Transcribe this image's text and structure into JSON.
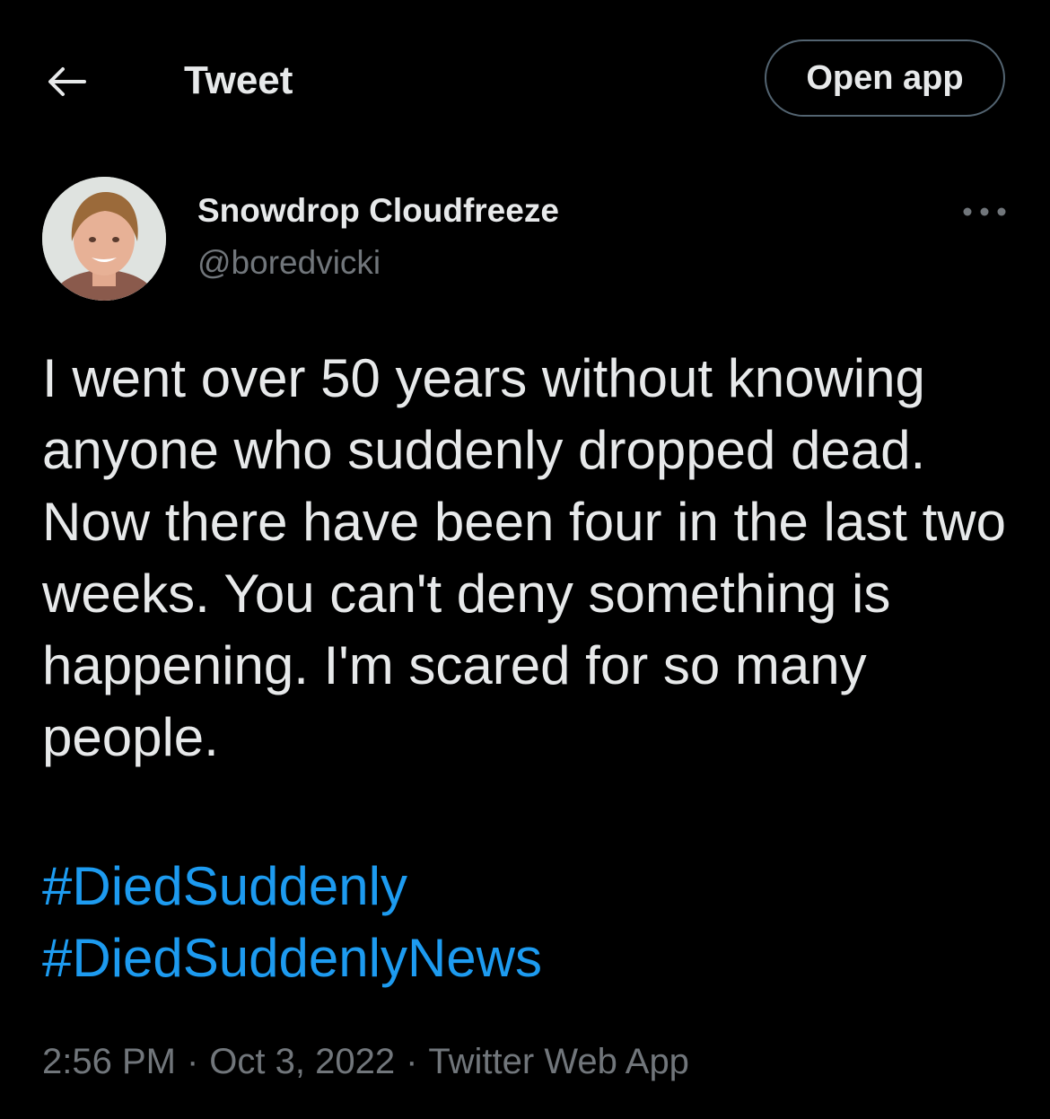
{
  "header": {
    "title": "Tweet",
    "open_app_label": "Open app",
    "back_icon": "arrow-left-icon"
  },
  "author": {
    "display_name": "Snowdrop Cloudfreeze",
    "handle": "@boredvicki",
    "avatar": "profile-photo",
    "more_icon": "more-horizontal-icon"
  },
  "tweet": {
    "text": "I went over 50 years without knowing anyone who suddenly dropped dead. Now there have been four in the last two weeks. You can't deny something is happening. I'm scared for so many people.",
    "hashtags": [
      "#DiedSuddenly",
      "#DiedSuddenlyNews"
    ]
  },
  "meta": {
    "time": "2:56 PM",
    "date": "Oct 3, 2022",
    "source": "Twitter Web App",
    "separator": "·"
  },
  "colors": {
    "background": "#000000",
    "text": "#e7e9ea",
    "secondary": "#71767b",
    "link": "#1d9bf0",
    "border": "#536471"
  }
}
